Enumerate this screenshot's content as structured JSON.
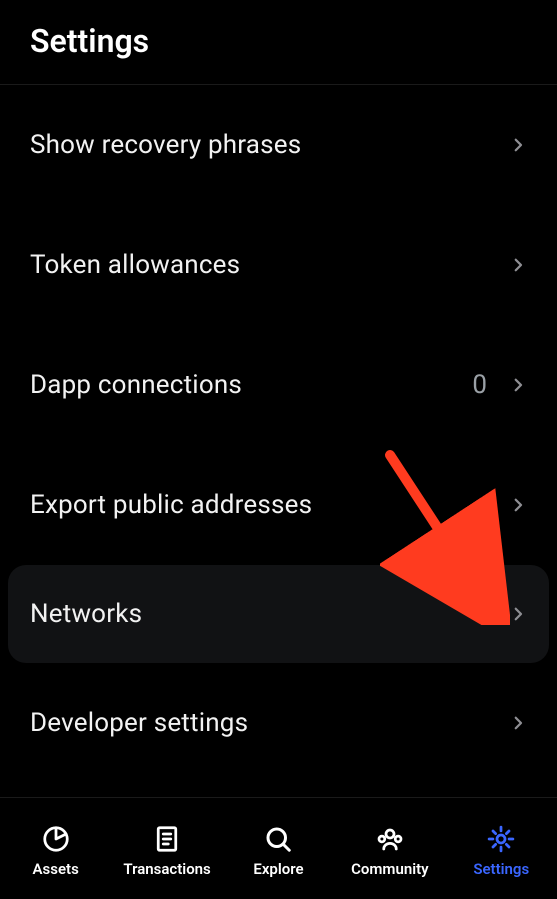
{
  "header": {
    "title": "Settings"
  },
  "rows": [
    {
      "label": "Show recovery phrases",
      "value": null,
      "highlight": false
    },
    {
      "label": "Token allowances",
      "value": null,
      "highlight": false
    },
    {
      "label": "Dapp connections",
      "value": "0",
      "highlight": false
    },
    {
      "label": "Export public addresses",
      "value": null,
      "highlight": false
    },
    {
      "label": "Networks",
      "value": null,
      "highlight": true
    },
    {
      "label": "Developer settings",
      "value": null,
      "highlight": false
    }
  ],
  "tabs": [
    {
      "label": "Assets",
      "active": false
    },
    {
      "label": "Transactions",
      "active": false
    },
    {
      "label": "Explore",
      "active": false
    },
    {
      "label": "Community",
      "active": false
    },
    {
      "label": "Settings",
      "active": true
    }
  ],
  "annotation": {
    "color": "#ff3b1f"
  }
}
